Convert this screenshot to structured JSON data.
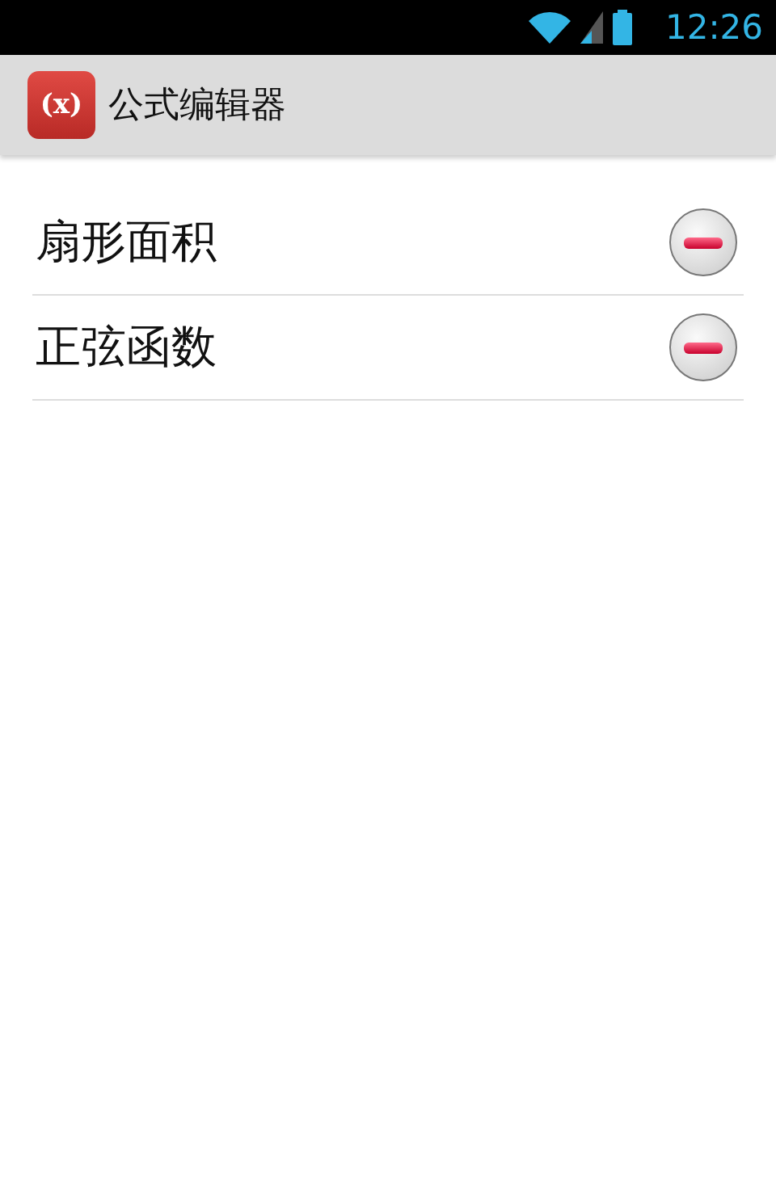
{
  "status_bar": {
    "time": "12:26"
  },
  "action_bar": {
    "logo": "(x)",
    "title": "公式编辑器"
  },
  "formulas": [
    {
      "name": "扇形面积"
    },
    {
      "name": "正弦函数"
    }
  ]
}
